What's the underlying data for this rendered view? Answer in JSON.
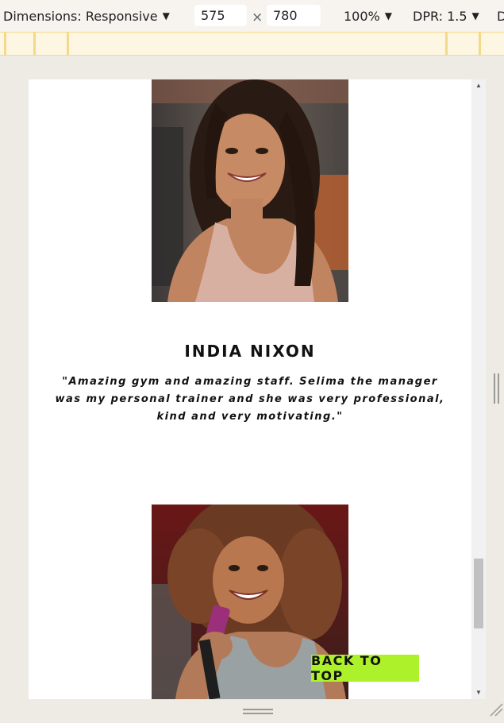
{
  "toolbar": {
    "dimensions_label": "Dimensions: Responsive",
    "width_value": "575",
    "times_symbol": "×",
    "height_value": "780",
    "zoom": "100%",
    "dpr": "DPR: 1.5",
    "more_label": "D"
  },
  "testimonials": [
    {
      "name": "INDIA NIXON",
      "quote": "\"Amazing gym and amazing staff. Selima the manager was my personal trainer and she was very professional, kind and very motivating.\""
    }
  ],
  "back_to_top": "BACK TO TOP",
  "colors": {
    "accent": "#adf12a",
    "ruler": "#f4d98b",
    "toolbar_bg": "#f7f3ef"
  },
  "icons": {
    "dropdown": "triangle-down-icon",
    "scroll_up": "scroll-up-arrow-icon",
    "scroll_down": "scroll-down-arrow-icon",
    "resize": "resize-corner-icon"
  }
}
